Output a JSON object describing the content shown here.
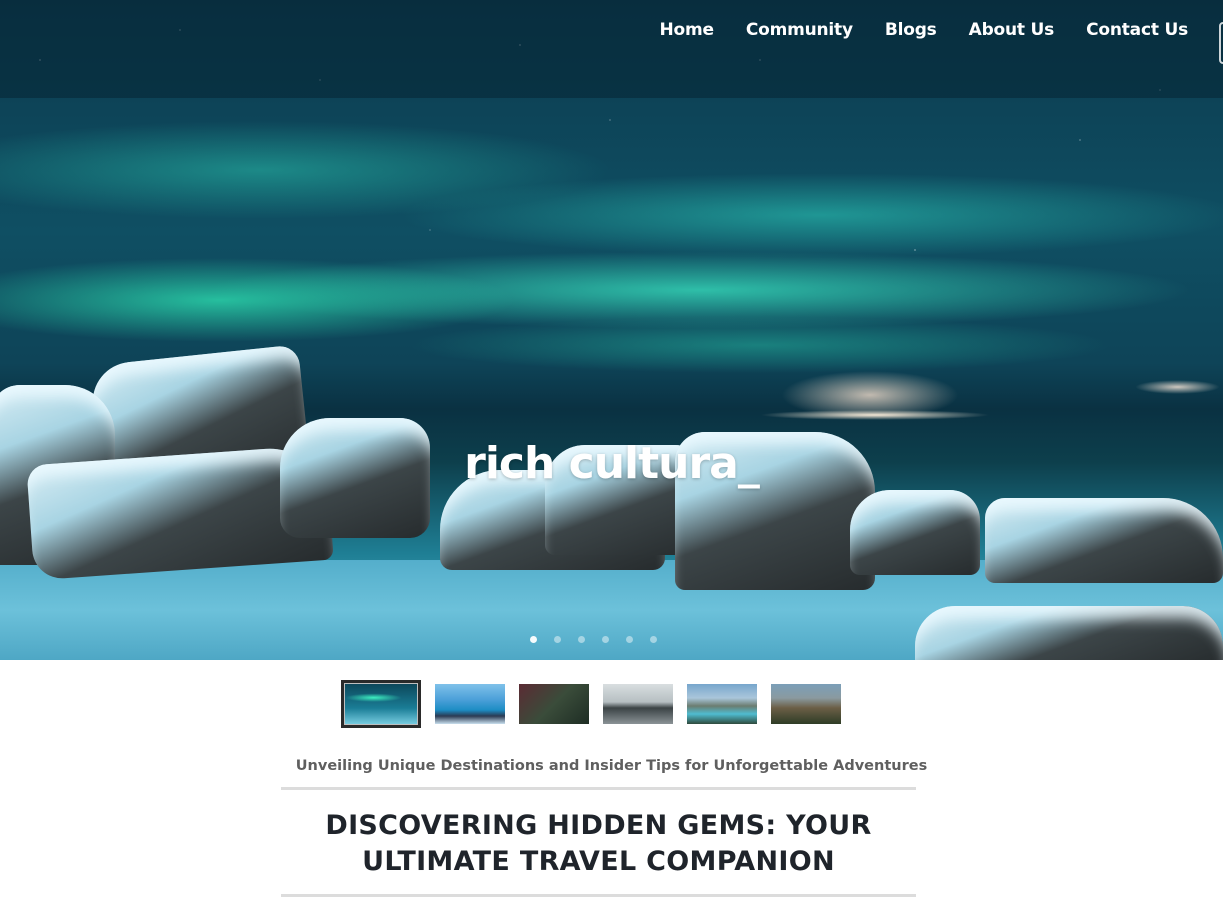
{
  "nav": {
    "items": [
      {
        "label": "Home"
      },
      {
        "label": "Community"
      },
      {
        "label": "Blogs"
      },
      {
        "label": "About Us"
      },
      {
        "label": "Contact Us"
      }
    ]
  },
  "hero": {
    "caption": "rich cultura_",
    "slide_count": 6,
    "active_slide": 1
  },
  "thumbnails": [
    {
      "icon": "aurora-thumbnail"
    },
    {
      "icon": "tropical-pool-thumbnail"
    },
    {
      "icon": "forest-thumbnail"
    },
    {
      "icon": "black-sand-beach-thumbnail"
    },
    {
      "icon": "mountain-lake-thumbnail"
    },
    {
      "icon": "mountain-valley-thumbnail"
    }
  ],
  "tagline": "Unveiling Unique Destinations and Insider Tips for Unforgettable Adventures",
  "headline": {
    "line1": "DISCOVERING HIDDEN GEMS: YOUR",
    "line2": "ULTIMATE TRAVEL COMPANION"
  },
  "colors": {
    "headline": "#1f242b",
    "tagline": "#5f5f5f",
    "rule": "#dcdcdc",
    "aurora": "#3df0c0"
  }
}
